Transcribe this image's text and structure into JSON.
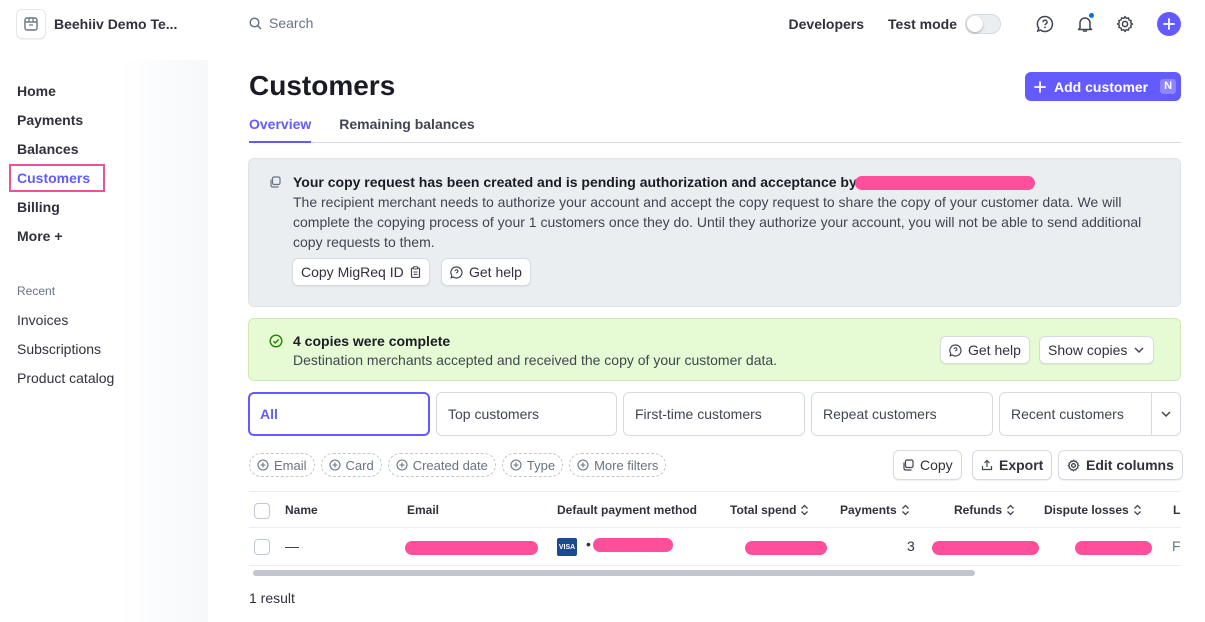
{
  "account": {
    "name": "Beehiiv Demo Te..."
  },
  "nav": {
    "items": [
      {
        "label": "Home"
      },
      {
        "label": "Payments"
      },
      {
        "label": "Balances"
      },
      {
        "label": "Customers"
      },
      {
        "label": "Billing"
      },
      {
        "label": "More +"
      }
    ],
    "recent_title": "Recent",
    "recent": [
      {
        "label": "Invoices"
      },
      {
        "label": "Subscriptions"
      },
      {
        "label": "Product catalog"
      }
    ]
  },
  "topbar": {
    "search_placeholder": "Search",
    "developers": "Developers",
    "test_mode": "Test mode"
  },
  "page": {
    "title": "Customers",
    "add_button": "Add customer",
    "add_shortcut": "N",
    "tabs": [
      "Overview",
      "Remaining balances"
    ]
  },
  "copy_banner": {
    "heading": "Your copy request has been created and is pending authorization and acceptance by",
    "body": "The recipient merchant needs to authorize your account and accept the copy request to share the copy of your customer data. We will complete the copying process of your 1 customers once they do. Until they authorize your account, you will not be able to send additional copy requests to them.",
    "copy_id_button": "Copy MigReq ID",
    "help_button": "Get help"
  },
  "complete_banner": {
    "heading": "4 copies were complete",
    "body": "Destination merchants accepted and received the copy of your customer data.",
    "help_button": "Get help",
    "show_button": "Show copies"
  },
  "filter_tabs": [
    "All",
    "Top customers",
    "First-time customers",
    "Repeat customers",
    "Recent customers"
  ],
  "filter_chips": [
    "Email",
    "Card",
    "Created date",
    "Type",
    "More filters"
  ],
  "tools": {
    "copy": "Copy",
    "export": "Export",
    "edit_columns": "Edit columns"
  },
  "table": {
    "headers": [
      "Name",
      "Email",
      "Default payment method",
      "Total spend",
      "Payments",
      "Refunds",
      "Dispute losses",
      "L"
    ],
    "row": {
      "name": "—",
      "card_brand": "VISA",
      "card_dot": "•",
      "payments": "3",
      "last": "F"
    }
  },
  "result_count": "1 result",
  "colors": {
    "accent": "#635bff",
    "highlight": "#f0509a",
    "redaction": "#ff4f9a"
  }
}
